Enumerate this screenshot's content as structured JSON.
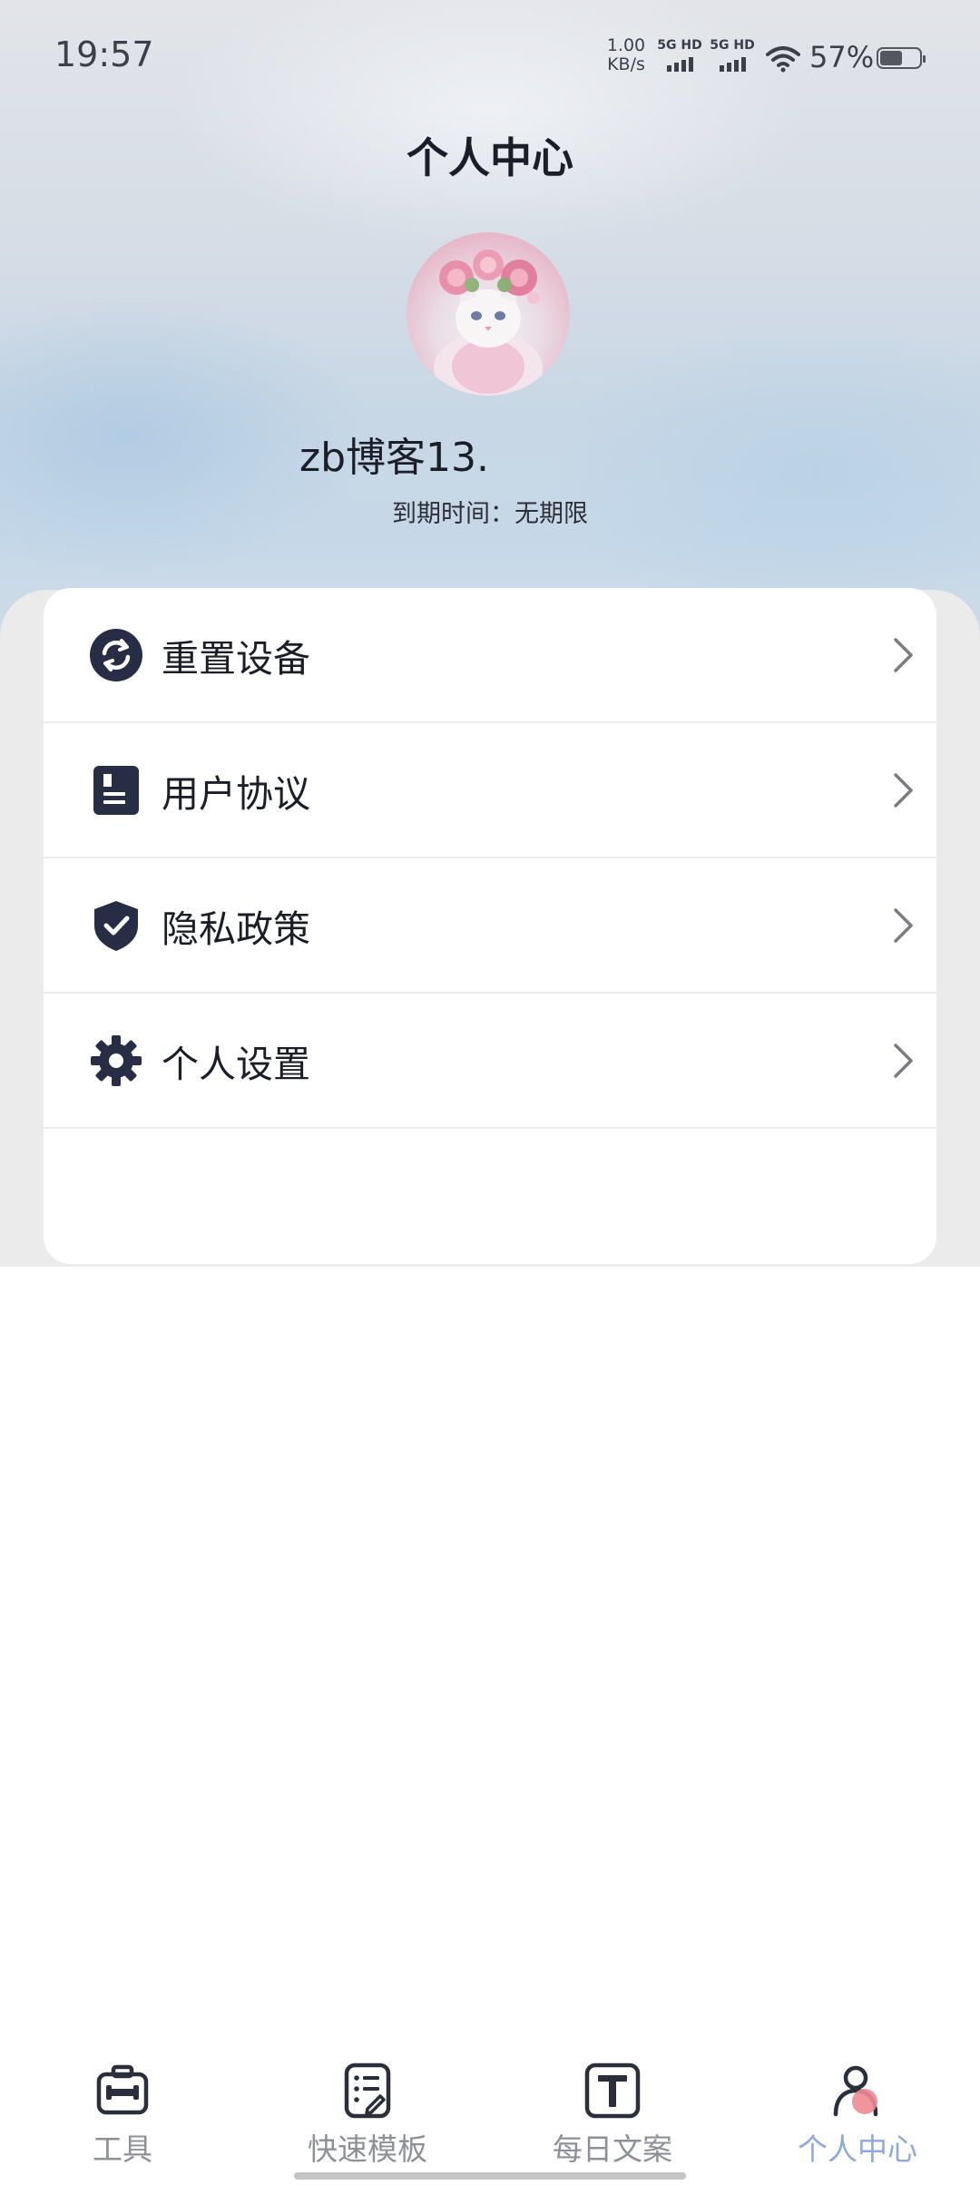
{
  "status_bar": {
    "time": "19:57",
    "net_speed_value": "1.00",
    "net_speed_unit": "KB/s",
    "signal_1_label": "5G HD",
    "signal_2_label": "5G HD",
    "battery_percent": "57%",
    "battery_level": 0.57
  },
  "header": {
    "title": "个人中心"
  },
  "profile": {
    "username": "zb博客13.",
    "expiry_text": "到期时间：无期限"
  },
  "menu": {
    "items": [
      {
        "label": "重置设备",
        "icon": "refresh-icon"
      },
      {
        "label": "用户协议",
        "icon": "document-icon"
      },
      {
        "label": "隐私政策",
        "icon": "shield-check-icon"
      },
      {
        "label": "个人设置",
        "icon": "gear-icon"
      }
    ]
  },
  "tabbar": {
    "active_color": "#8ea9e0",
    "inactive_color": "#8e9097",
    "items": [
      {
        "label": "工具",
        "icon": "toolbox-icon"
      },
      {
        "label": "快速模板",
        "icon": "template-icon"
      },
      {
        "label": "每日文案",
        "icon": "text-icon"
      },
      {
        "label": "个人中心",
        "icon": "person-icon",
        "active": true
      }
    ]
  }
}
